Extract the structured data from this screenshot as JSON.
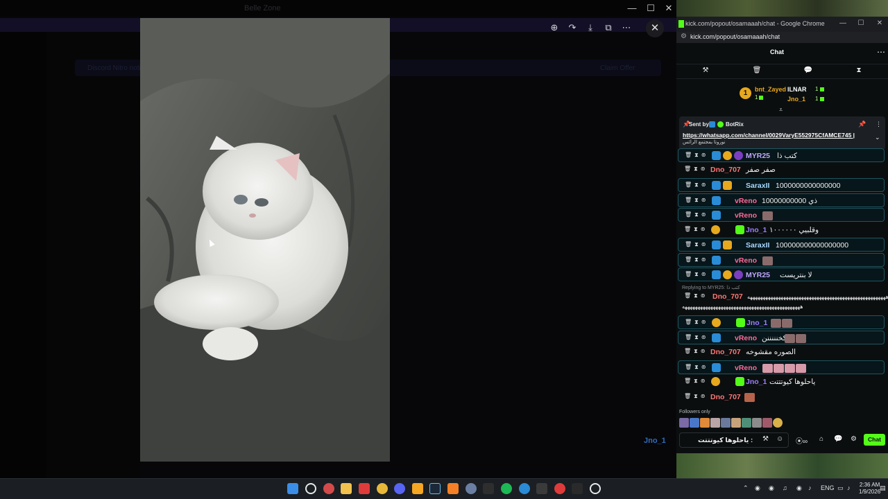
{
  "discord": {
    "window_title": "Belle Zone",
    "notice_text": "Discord Nitro notice",
    "notice_button": "Claim Offer"
  },
  "viewer": {
    "tool_icons": [
      "zoom-in-icon",
      "rotate-icon",
      "download-icon",
      "open-external-icon",
      "more-icon"
    ],
    "close_icon": "close-icon"
  },
  "chrome": {
    "title": "kick.com/popout/osamaaah/chat - Google Chrome",
    "url": "kick.com/popout/osamaaah/chat"
  },
  "chat": {
    "title": "Chat",
    "toolbar_icons": [
      "hammer-icon",
      "trash-icon",
      "chat-bubble-icon",
      "hourglass-icon"
    ],
    "leaderboard": [
      {
        "name": "bnt_Zayed",
        "count": "1",
        "color": "#e7a81d"
      },
      {
        "name": "ILNAR",
        "count": "1",
        "color": "#ffffff"
      },
      {
        "name": "Jno_1",
        "count": "1",
        "color": "#e7a81d"
      }
    ],
    "pinned": {
      "label": "Sent by",
      "sender": "BotRix",
      "link": "https://whatsapp.com/channel/0029VaryE552975CfAMCE745 |",
      "subtext": "نوروتا بمجتمع الرائس"
    },
    "messages": [
      {
        "name": "MYR25",
        "text": "كتب ذا",
        "color": "#bfa8ff",
        "hl": true
      },
      {
        "name": "Dno_707",
        "text": "صفر صفر",
        "color": "#ff7777",
        "hl": false
      },
      {
        "name": "SaraxII",
        "text": "1000000000000000",
        "color": "#a8d8ff",
        "hl": true
      },
      {
        "name": "vReno",
        "text": "10000000000 ذي",
        "color": "#ff6a9a",
        "hl": true
      },
      {
        "name": "vReno",
        "text": "",
        "color": "#ff6a9a",
        "hl": true
      },
      {
        "name": "Jno_1",
        "text": "وقلبيي ١٠٠٠٠٠٠",
        "color": "#9d7dff",
        "hl": false
      },
      {
        "name": "SaraxII",
        "text": "100000000000000000",
        "color": "#a8d8ff",
        "hl": true
      },
      {
        "name": "vReno",
        "text": "",
        "color": "#ff6a9a",
        "hl": true
      },
      {
        "name": "MYR25",
        "text": "لا بنتريست",
        "color": "#bfa8ff",
        "hl": true
      }
    ],
    "reply": {
      "label": "Replying to MYR25: كتب ذا",
      "name": "Dno_707",
      "text": "ههههههههههههههههههههههههههههههههههههههههههههههههههههههه",
      "text2": "ههههههههههههههههههههههههههههههههههههههههههههههه"
    },
    "messages2": [
      {
        "name": "Jno_1",
        "text": "",
        "color": "#9d7dff",
        "hl": true
      },
      {
        "name": "vReno",
        "text": "كخنننننن",
        "color": "#ff6a9a",
        "hl": true
      },
      {
        "name": "Dno_707",
        "text": "الصوره مقشوخه",
        "color": "#ff7777",
        "hl": false
      },
      {
        "name": "vReno",
        "text": "",
        "color": "#ff6a9a",
        "hl": true
      },
      {
        "name": "Jno_1",
        "text": "ياحلوها كيوتتتت",
        "color": "#9d7dff",
        "hl": false
      },
      {
        "name": "Dno_707",
        "text": "",
        "color": "#ff7777",
        "hl": false
      }
    ],
    "followers_only": "Followers only",
    "input_value": "ياحلوها كيوتتتت :",
    "overlay_user": "Jno_1",
    "send_label": "Chat"
  },
  "taskbar": {
    "lang": "ENG",
    "time": "2:36 AM",
    "date": "1/9/2026"
  }
}
